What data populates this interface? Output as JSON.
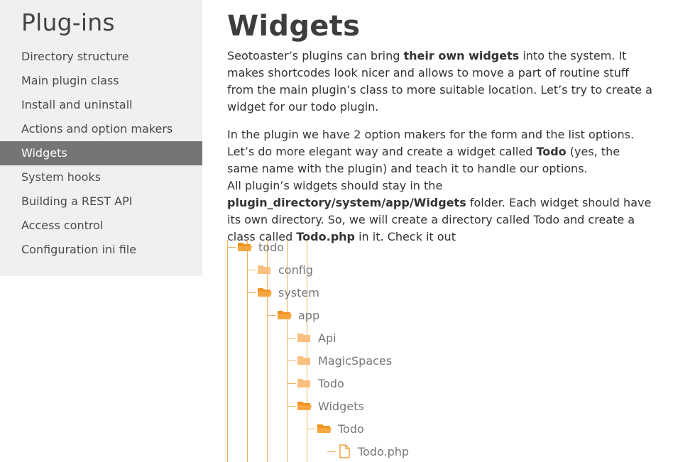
{
  "sidebar": {
    "title": "Plug-ins",
    "items": [
      {
        "label": "Directory structure"
      },
      {
        "label": "Main plugin class"
      },
      {
        "label": "Install and uninstall"
      },
      {
        "label": "Actions and option makers"
      },
      {
        "label": "Widgets",
        "active": true
      },
      {
        "label": "System hooks"
      },
      {
        "label": "Building a REST API"
      },
      {
        "label": "Access control"
      },
      {
        "label": "Configuration ini file"
      }
    ]
  },
  "main": {
    "title": "Widgets",
    "p1": {
      "a": "Seotoaster’s plugins can bring ",
      "b": "their own widgets",
      "c": " into the system. It makes shortcodes look nicer and allows to move a part of routine stuff from the main plugin’s class to more suitable location. Let’s try to create a widget for our todo plugin."
    },
    "p2": {
      "a": "In the plugin we have 2 option makers for the form and the list options. Let’s do more elegant way and create a widget called ",
      "b": "Todo",
      "c": " (yes, the same name with the plugin) and teach it to handle our options.",
      "d": "All plugin’s widgets should stay in the ",
      "e": "plugin_directory/system/app/Widgets",
      "f": " folder. Each widget should have its own directory. So, we will create a directory called Todo and create a class called ",
      "g": "Todo.php",
      "h": " in it. Check it out"
    }
  },
  "tree": {
    "colors": {
      "line": "#f0b060",
      "open": "#f39321",
      "closed": "#fbc07f",
      "file": "#f0a040"
    },
    "nodes": [
      {
        "label": "todo",
        "icon": "folder-open-icon"
      },
      {
        "label": "config",
        "icon": "folder-icon"
      },
      {
        "label": "system",
        "icon": "folder-open-icon"
      },
      {
        "label": "app",
        "icon": "folder-open-icon"
      },
      {
        "label": "Api",
        "icon": "folder-icon"
      },
      {
        "label": "MagicSpaces",
        "icon": "folder-icon"
      },
      {
        "label": "Todo",
        "icon": "folder-icon"
      },
      {
        "label": "Widgets",
        "icon": "folder-open-icon"
      },
      {
        "label": "Todo",
        "icon": "folder-open-icon"
      },
      {
        "label": "Todo.php",
        "icon": "file-icon"
      }
    ]
  }
}
